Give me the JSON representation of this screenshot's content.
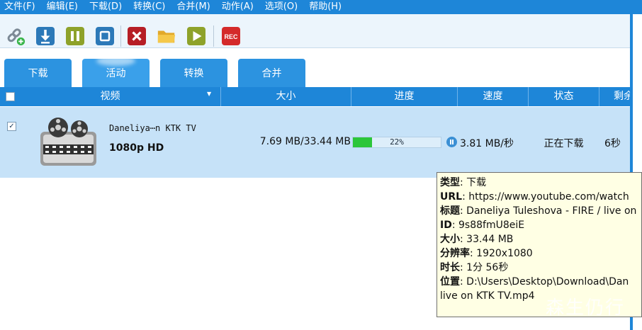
{
  "menu": [
    "文件(F)",
    "编辑(E)",
    "下载(D)",
    "转换(C)",
    "合并(M)",
    "动作(A)",
    "选项(O)",
    "帮助(H)"
  ],
  "toolbar": {
    "rec_label": "REC",
    "icons": [
      "link-add-icon",
      "download-arrow-icon",
      "pause-icon",
      "stop-icon",
      "delete-icon",
      "folder-icon",
      "play-icon",
      "rec-icon"
    ]
  },
  "tabs": [
    "下载",
    "活动",
    "转换",
    "合并"
  ],
  "active_tab": "活动",
  "table": {
    "headers": {
      "video": "视频",
      "size": "大小",
      "progress": "进度",
      "speed": "速度",
      "status": "状态",
      "remaining": "剩余"
    }
  },
  "row": {
    "checked": true,
    "check_mark": "✓",
    "title": "Daneliya⋯n KTK TV",
    "quality": "1080p HD",
    "size": "7.69 MB/33.44 MB",
    "progress_fraction": 0.22,
    "progress_text": "22%",
    "speed": "3.81 MB/秒",
    "status": "正在下载",
    "remaining": "6秒"
  },
  "tooltip": {
    "type_label": "类型",
    "type_value": "下载",
    "url_label": "URL",
    "url_value": "https://www.youtube.com/watch",
    "title_label": "标题",
    "title_value": "Daneliya Tuleshova - FIRE / live on",
    "id_label": "ID",
    "id_value": "9s88fmU8eiE",
    "size_label": "大小",
    "size_value": "33.44 MB",
    "resolution_label": "分辨率",
    "resolution_value": "1920x1080",
    "duration_label": "时长",
    "duration_value": "1分 56秒",
    "location_label": "位置",
    "location_value": "D:\\Users\\Desktop\\Download\\Dan",
    "location_cont": "live on KTK TV.mp4"
  },
  "watermark": "森生仍行",
  "colors": {
    "menubar": "#1e86d8",
    "tab": "#2c93e0",
    "row_selected": "#c6e2f8",
    "progress": "#2bc63a",
    "tooltip_bg": "#ffffe4"
  }
}
